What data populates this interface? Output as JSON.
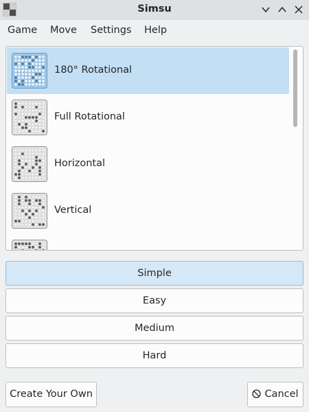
{
  "window": {
    "title": "Simsu",
    "app_icon": "simsu-app-icon"
  },
  "window_buttons": [
    "minimize-icon",
    "maximize-icon",
    "close-icon"
  ],
  "menu": [
    "Game",
    "Move",
    "Settings",
    "Help"
  ],
  "symmetry_list": {
    "items": [
      {
        "label": "180° Rotational",
        "selected": true
      },
      {
        "label": "Full Rotational",
        "selected": false
      },
      {
        "label": "Horizontal",
        "selected": false
      },
      {
        "label": "Vertical",
        "selected": false
      },
      {
        "label": "",
        "selected": false
      }
    ]
  },
  "difficulty": {
    "options": [
      "Simple",
      "Easy",
      "Medium",
      "Hard"
    ],
    "selected": "Simple"
  },
  "buttons": {
    "create": "Create Your Own",
    "cancel": "Cancel",
    "cancel_icon": "cancel-icon"
  },
  "colors": {
    "selection": "#c3dff3",
    "active_button": "#d5e8f7"
  }
}
